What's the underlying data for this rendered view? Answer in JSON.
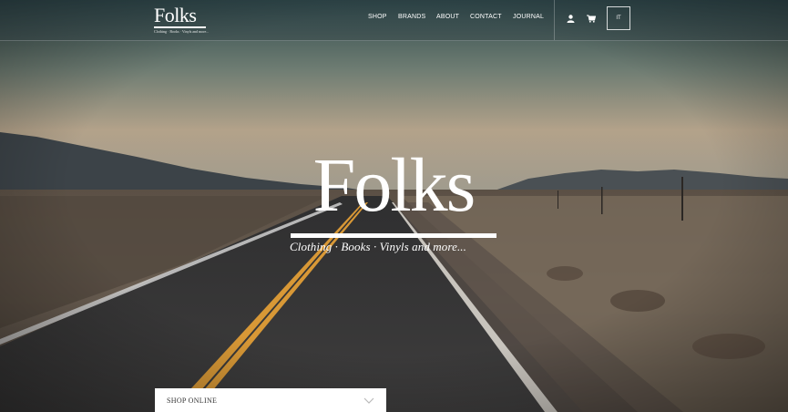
{
  "header": {
    "logo_text": "Folks",
    "logo_tagline": "Clothing · Books · Vinyls and more...",
    "nav": [
      {
        "label": "SHOP"
      },
      {
        "label": "BRANDS"
      },
      {
        "label": "ABOUT"
      },
      {
        "label": "CONTACT"
      },
      {
        "label": "JOURNAL"
      }
    ],
    "icons": [
      "user-icon",
      "cart-icon"
    ],
    "language_button": "IT"
  },
  "hero": {
    "logo_text": "Folks",
    "tagline": "Clothing · Books · Vinyls and more..."
  },
  "shop_dropdown": {
    "label": "SHOP ONLINE",
    "icon": "chevron-down-icon"
  },
  "colors": {
    "text": "#ffffff",
    "dropdown_bg": "#ffffff",
    "road_line": "#e0a03a"
  }
}
